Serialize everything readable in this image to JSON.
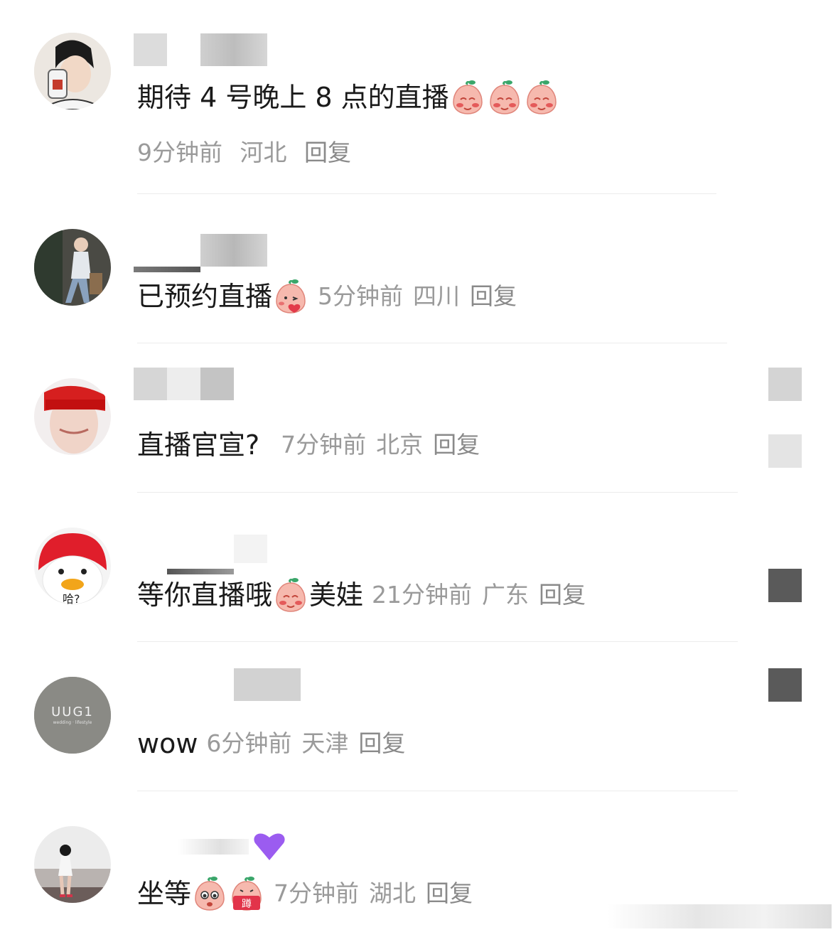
{
  "comments": [
    {
      "text": "期待 4 号晚上 8 点的直播",
      "time": "9分钟前",
      "location": "河北",
      "reply": "回复",
      "emojis": [
        "peach-shy",
        "peach-shy",
        "peach-shy"
      ]
    },
    {
      "text": "已预约直播",
      "time": "5分钟前",
      "location": "四川",
      "reply": "回复",
      "emojis": [
        "peach-kiss"
      ]
    },
    {
      "text": "直播官宣?",
      "time": "7分钟前",
      "location": "北京",
      "reply": "回复",
      "emojis": []
    },
    {
      "text": "等你直播哦",
      "text_after": "美娃",
      "time": "21分钟前",
      "location": "广东",
      "reply": "回复",
      "emojis": [
        "peach-shy"
      ]
    },
    {
      "text": "wow",
      "time": "6分钟前",
      "location": "天津",
      "reply": "回复",
      "emojis": []
    },
    {
      "text": "坐等",
      "time": "7分钟前",
      "location": "湖北",
      "reply": "回复",
      "emojis": [
        "peach-eyes",
        "peach-squat"
      ]
    }
  ],
  "avatars": {
    "avatar_5_text": "UUG1",
    "avatar_5_sub": "wedding · lifestyle",
    "avatar_4_text": "哈?"
  },
  "emoji_labels": {
    "squat": "蹲"
  },
  "colors": {
    "meta_gray": "#9a9a9a",
    "text": "#1a1a1a",
    "divider": "#ececec"
  }
}
